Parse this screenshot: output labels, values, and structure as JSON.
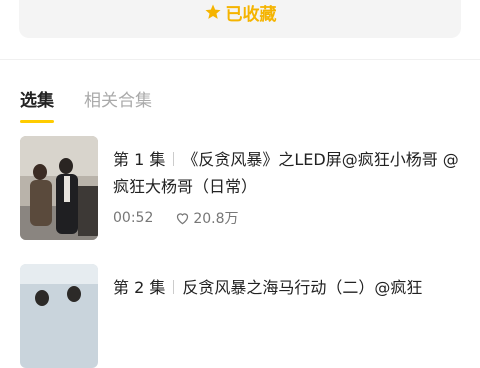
{
  "favorite": {
    "label": "已收藏",
    "icon": "star-icon",
    "color": "#f5b400"
  },
  "tabs": [
    {
      "label": "选集",
      "active": true
    },
    {
      "label": "相关合集",
      "active": false
    }
  ],
  "episodes": [
    {
      "number": "第 1 集",
      "title": "《反贪风暴》之LED屏@疯狂小杨哥 @疯狂大杨哥（日常）",
      "duration": "00:52",
      "likes": "20.8万",
      "like_icon": "heart-icon"
    },
    {
      "number": "第 2 集",
      "title": "反贪风暴之海马行动（二）@疯狂"
    }
  ],
  "colors": {
    "accent": "#ffcc00",
    "tab_inactive": "#aaaaaa"
  }
}
